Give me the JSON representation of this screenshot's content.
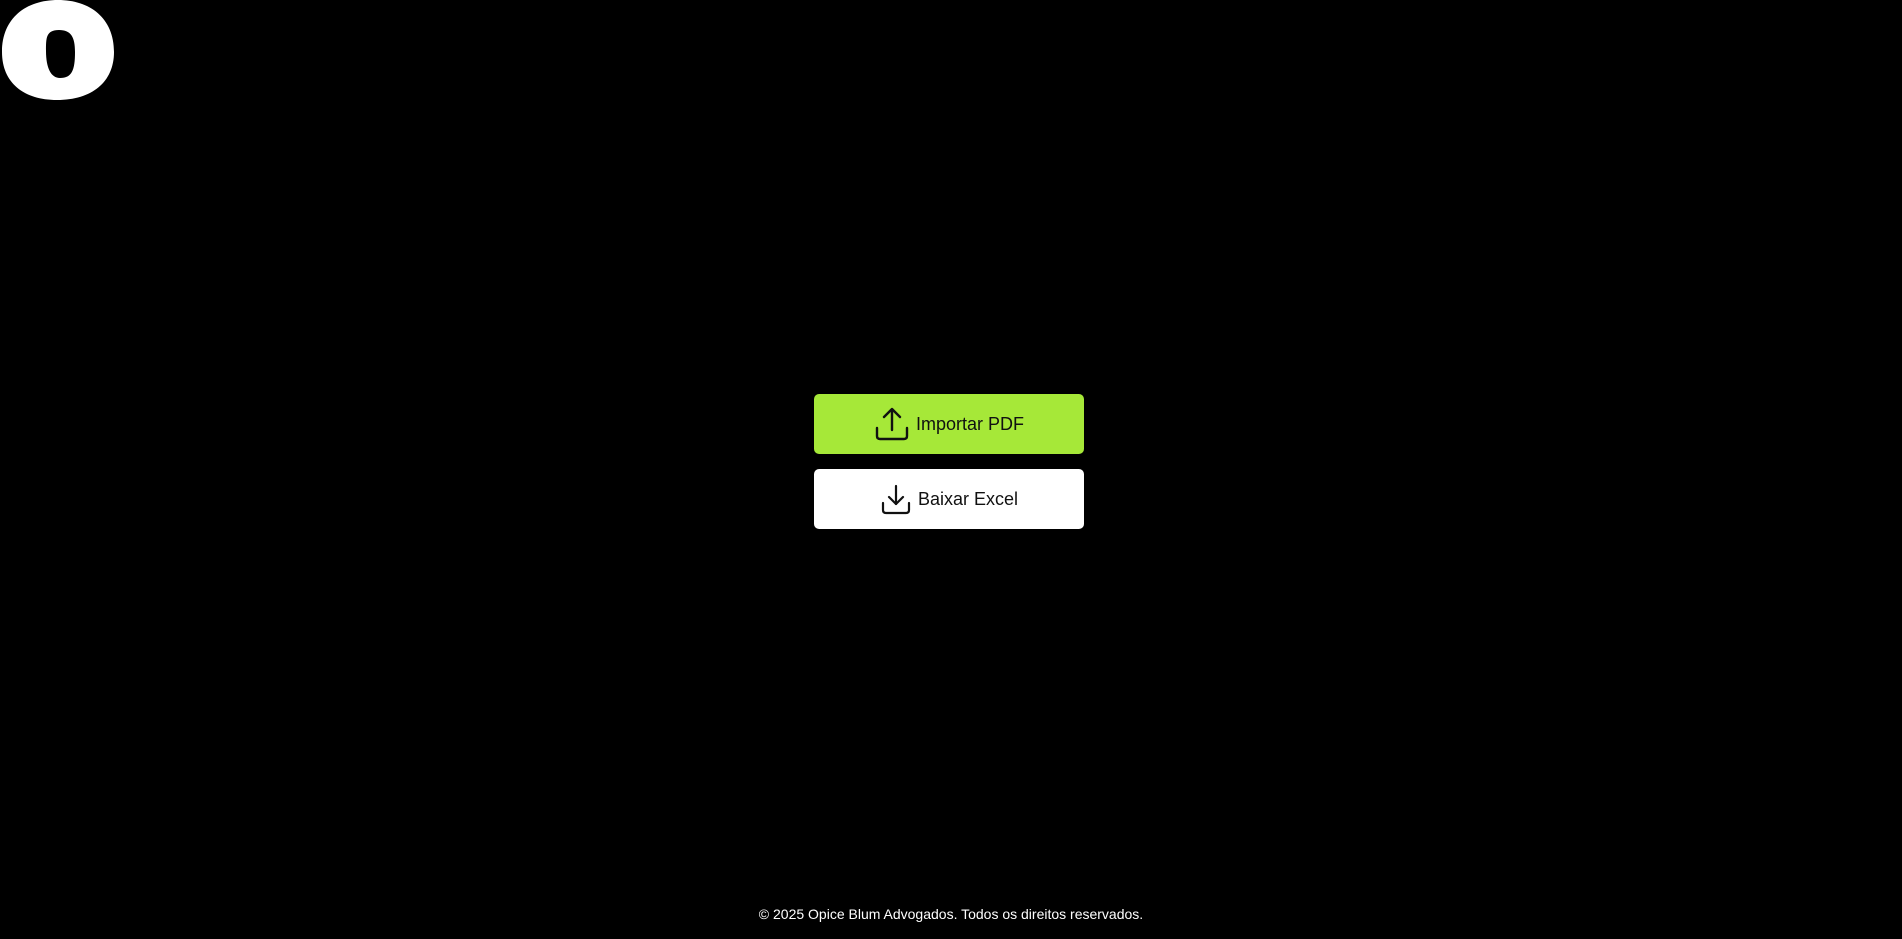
{
  "brand": {
    "logo_icon": "brand-o-logo-icon",
    "logo_color": "#ffffff"
  },
  "actions": {
    "import_pdf": {
      "label": "Importar PDF",
      "icon": "upload-icon",
      "background": "#a6e838"
    },
    "download_excel": {
      "label": "Baixar Excel",
      "icon": "download-icon",
      "background": "#ffffff"
    }
  },
  "footer": {
    "copyright": "© 2025 Opice Blum Advogados. Todos os direitos reservados."
  },
  "theme": {
    "background": "#000000",
    "text_dark": "#111111",
    "text_light": "#ffffff"
  }
}
